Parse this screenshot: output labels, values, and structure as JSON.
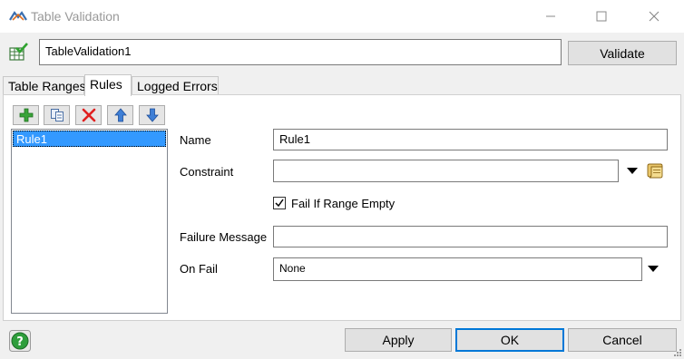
{
  "window": {
    "title": "Table Validation",
    "controls": [
      "minimize-icon",
      "maximize-icon",
      "close-icon"
    ]
  },
  "header": {
    "object_name": "TableValidation1",
    "validate_label": "Validate"
  },
  "tabs": [
    {
      "label": "Table Ranges",
      "active": false
    },
    {
      "label": "Rules",
      "active": true
    },
    {
      "label": "Logged Errors",
      "active": false
    }
  ],
  "toolbar": {
    "icons": [
      "add-icon",
      "duplicate-icon",
      "delete-icon",
      "move-up-icon",
      "move-down-icon"
    ]
  },
  "rules": {
    "items": [
      "Rule1"
    ],
    "selected_index": 0
  },
  "form": {
    "name_label": "Name",
    "name_value": "Rule1",
    "constraint_label": "Constraint",
    "constraint_value": "",
    "fail_if_empty_label": "Fail If Range Empty",
    "fail_if_empty_checked": true,
    "failure_message_label": "Failure Message",
    "failure_message_value": "",
    "on_fail_label": "On Fail",
    "on_fail_value": "None"
  },
  "footer": {
    "apply_label": "Apply",
    "ok_label": "OK",
    "cancel_label": "Cancel"
  },
  "colors": {
    "selection": "#3399ff",
    "default_button_border": "#0078d7",
    "window_bg": "#f0f0f0"
  }
}
